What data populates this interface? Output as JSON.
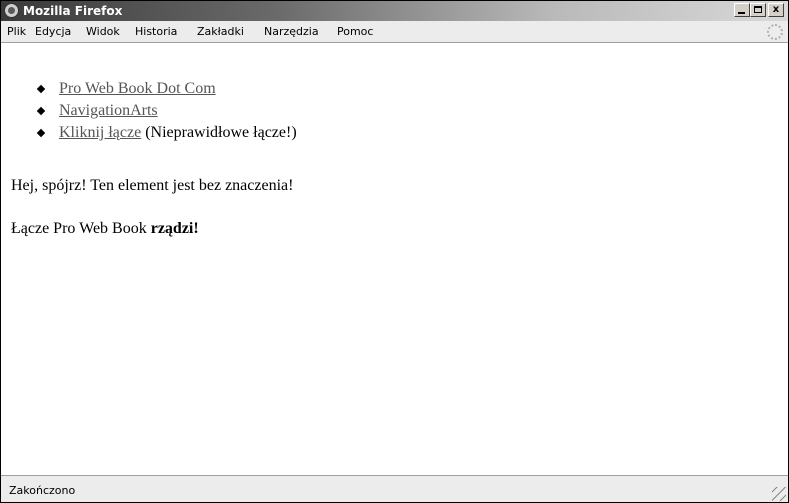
{
  "window": {
    "title": "Mozilla Firefox",
    "controls": {
      "minimize": "_",
      "maximize": "□",
      "close": "x"
    }
  },
  "menu": {
    "items": [
      "Plik",
      "Edycja",
      "Widok",
      "Historia",
      "Zakładki",
      "Narzędzia",
      "Pomoc"
    ]
  },
  "content": {
    "list": {
      "items": [
        {
          "link_text": "Pro Web Book Dot Com",
          "suffix": ""
        },
        {
          "link_text": "NavigationArts",
          "suffix": ""
        },
        {
          "link_text": "Kliknij łącze",
          "suffix": " (Nieprawidłowe łącze!)"
        }
      ]
    },
    "paragraph1": "Hej, spójrz! Ten element jest bez znaczenia!",
    "paragraph2": {
      "prefix": "Łącze Pro Web Book ",
      "bold": "rządzi",
      "suffix": "!"
    }
  },
  "status": {
    "text": "Zakończono"
  },
  "icons": {
    "app": "firefox-logo-icon",
    "throbber": "loading-throbber-icon",
    "grip": "resize-grip-icon"
  }
}
